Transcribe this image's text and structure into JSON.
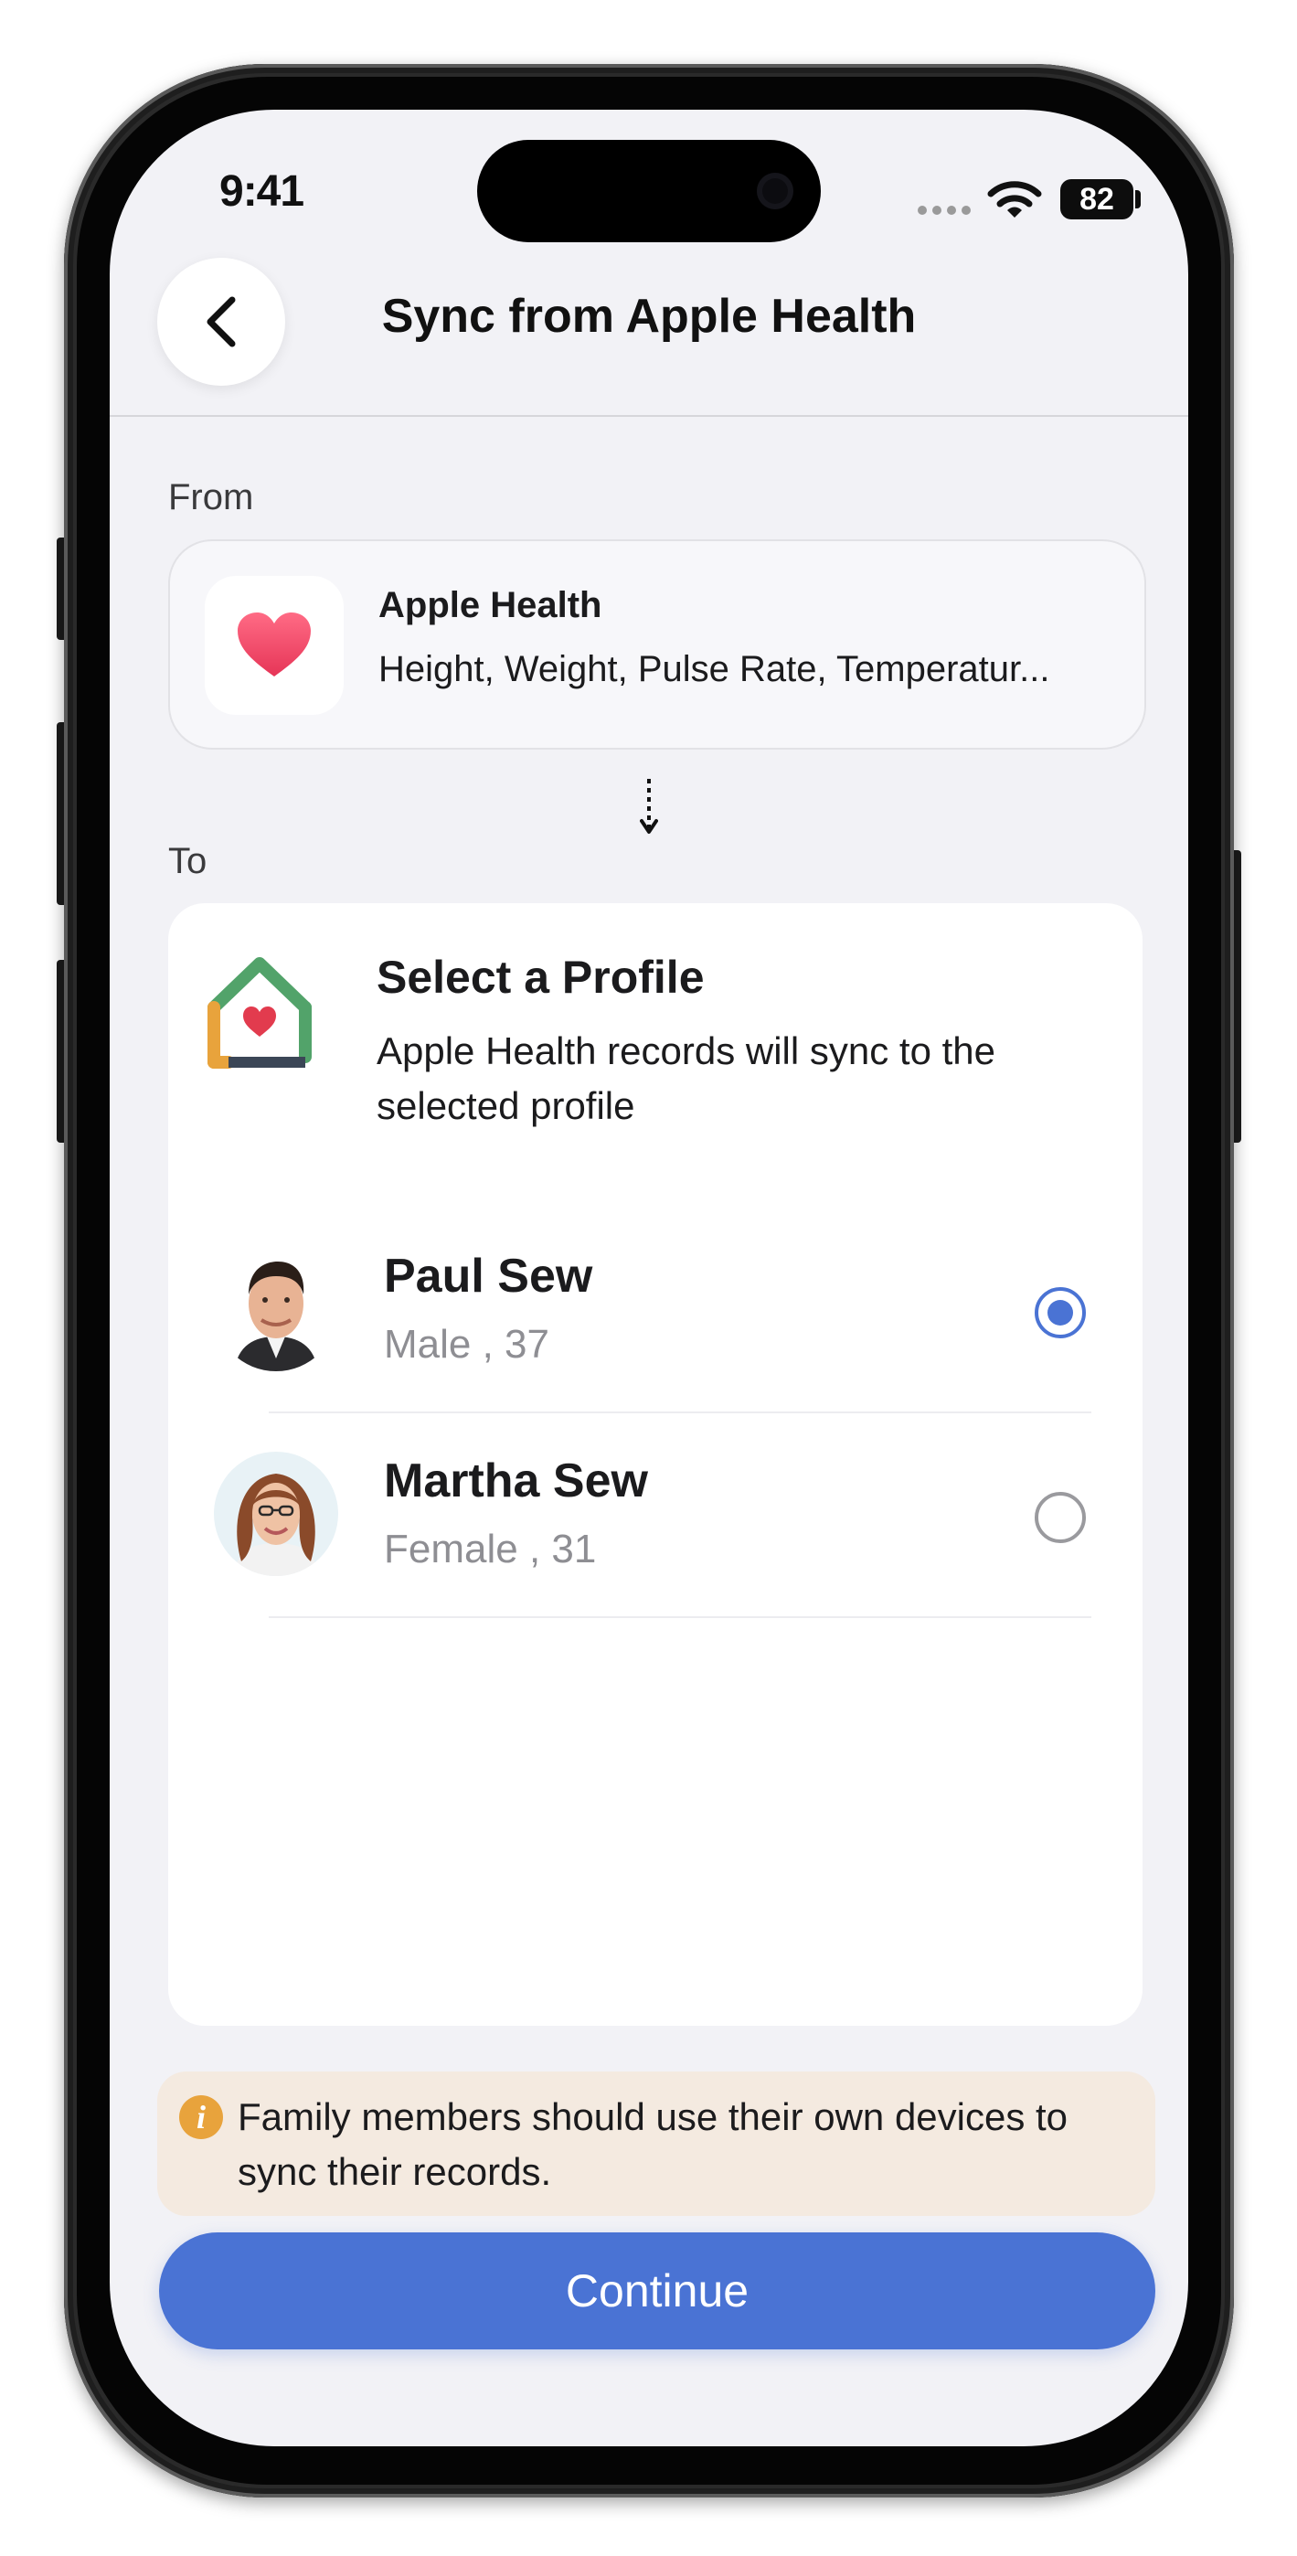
{
  "status_bar": {
    "time": "9:41",
    "battery_level": "82"
  },
  "nav": {
    "title": "Sync from Apple Health",
    "back_icon": "chevron-left-icon"
  },
  "from_section": {
    "label": "From",
    "source_title": "Apple Health",
    "source_items": "Height, Weight, Pulse Rate, Temperatur...",
    "icon": "heart-icon"
  },
  "to_section": {
    "label": "To",
    "card_title": "Select a Profile",
    "card_description": "Apple Health records will sync to the selected profile",
    "icon": "house-heart-icon"
  },
  "profiles": [
    {
      "name": "Paul Sew",
      "meta": "Male , 37",
      "selected": true
    },
    {
      "name": "Martha Sew",
      "meta": "Female , 31",
      "selected": false
    }
  ],
  "info_banner": {
    "icon": "info-icon",
    "icon_glyph": "i",
    "text": "Family members should use their own devices to sync their records."
  },
  "continue_button": {
    "label": "Continue"
  },
  "colors": {
    "accent": "#4a73d4",
    "info_bg": "#f4eae0",
    "info_icon": "#e8a33c",
    "heart": "#e8455f"
  }
}
